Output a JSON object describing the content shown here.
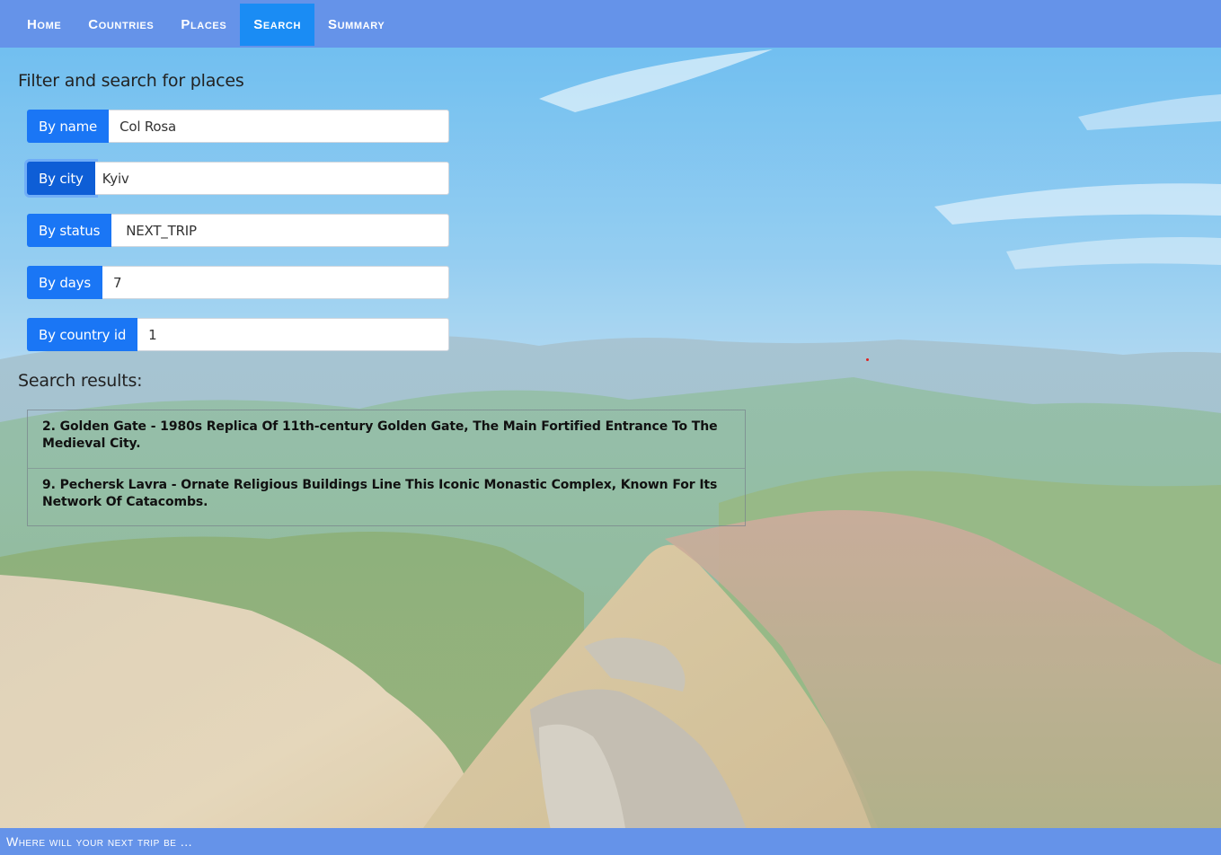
{
  "nav": {
    "items": [
      {
        "label": "Home"
      },
      {
        "label": "Countries"
      },
      {
        "label": "Places"
      },
      {
        "label": "Search",
        "active": true
      },
      {
        "label": "Summary"
      }
    ]
  },
  "filter": {
    "title": "Filter and search for places",
    "fields": {
      "name": {
        "label": "By name",
        "value": "Col Rosa"
      },
      "city": {
        "label": "By city",
        "value": "Kyiv"
      },
      "status": {
        "label": "By status",
        "value": "NEXT_TRIP"
      },
      "days": {
        "label": "By days",
        "value": "7"
      },
      "country": {
        "label": "By country id",
        "value": "1"
      }
    }
  },
  "results": {
    "title": "Search results:",
    "items": [
      {
        "text": "2. Golden Gate - 1980s Replica Of 11th-century Golden Gate, The Main Fortified Entrance To The Medieval City."
      },
      {
        "text": "9. Pechersk Lavra - Ornate Religious Buildings Line This Iconic Monastic Complex, Known For Its Network Of Catacombs."
      }
    ]
  },
  "footer": {
    "text": "Where will your next trip be ..."
  },
  "colors": {
    "nav_bg": "#6593e9",
    "nav_active": "#1a8cf4",
    "label_bg": "#1a76f5"
  }
}
